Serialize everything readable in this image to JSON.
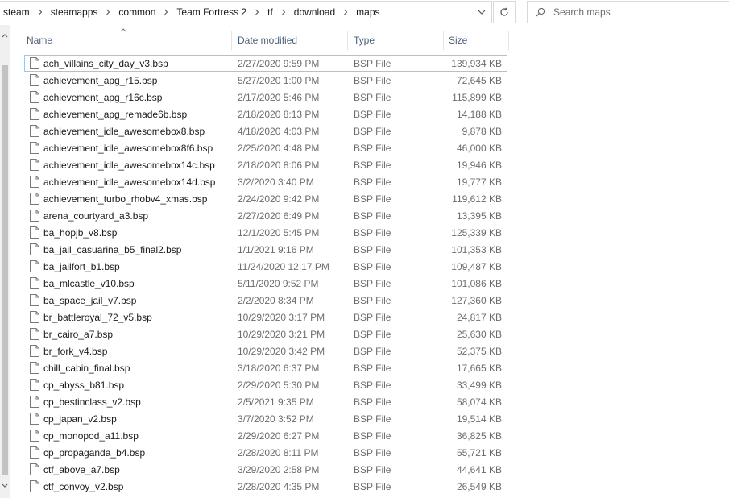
{
  "address_bar": {
    "breadcrumbs": [
      "steam",
      "steamapps",
      "common",
      "Team Fortress 2",
      "tf",
      "download",
      "maps"
    ],
    "separator_icon": "chevron-right-icon",
    "dropdown_icon": "chevron-down-icon",
    "refresh_icon": "refresh-icon"
  },
  "search": {
    "placeholder": "Search maps",
    "value": "",
    "icon": "search-icon"
  },
  "columns": {
    "name": "Name",
    "date_modified": "Date modified",
    "type": "Type",
    "size": "Size",
    "sort_column": "Name",
    "sort_direction": "ascending"
  },
  "files": [
    {
      "name": "ach_villains_city_day_v3.bsp",
      "date": "2/27/2020 9:59 PM",
      "type": "BSP File",
      "size": "139,934 KB"
    },
    {
      "name": "achievement_apg_r15.bsp",
      "date": "5/27/2020 1:00 PM",
      "type": "BSP File",
      "size": "72,645 KB"
    },
    {
      "name": "achievement_apg_r16c.bsp",
      "date": "2/17/2020 5:46 PM",
      "type": "BSP File",
      "size": "115,899 KB"
    },
    {
      "name": "achievement_apg_remade6b.bsp",
      "date": "2/18/2020 8:13 PM",
      "type": "BSP File",
      "size": "14,188 KB"
    },
    {
      "name": "achievement_idle_awesomebox8.bsp",
      "date": "4/18/2020 4:03 PM",
      "type": "BSP File",
      "size": "9,878 KB"
    },
    {
      "name": "achievement_idle_awesomebox8f6.bsp",
      "date": "2/25/2020 4:48 PM",
      "type": "BSP File",
      "size": "46,000 KB"
    },
    {
      "name": "achievement_idle_awesomebox14c.bsp",
      "date": "2/18/2020 8:06 PM",
      "type": "BSP File",
      "size": "19,946 KB"
    },
    {
      "name": "achievement_idle_awesomebox14d.bsp",
      "date": "3/2/2020 3:40 PM",
      "type": "BSP File",
      "size": "19,777 KB"
    },
    {
      "name": "achievement_turbo_rhobv4_xmas.bsp",
      "date": "2/24/2020 9:42 PM",
      "type": "BSP File",
      "size": "119,612 KB"
    },
    {
      "name": "arena_courtyard_a3.bsp",
      "date": "2/27/2020 6:49 PM",
      "type": "BSP File",
      "size": "13,395 KB"
    },
    {
      "name": "ba_hopjb_v8.bsp",
      "date": "12/1/2020 5:45 PM",
      "type": "BSP File",
      "size": "125,339 KB"
    },
    {
      "name": "ba_jail_casuarina_b5_final2.bsp",
      "date": "1/1/2021 9:16 PM",
      "type": "BSP File",
      "size": "101,353 KB"
    },
    {
      "name": "ba_jailfort_b1.bsp",
      "date": "11/24/2020 12:17 PM",
      "type": "BSP File",
      "size": "109,487 KB"
    },
    {
      "name": "ba_mlcastle_v10.bsp",
      "date": "5/11/2020 9:52 PM",
      "type": "BSP File",
      "size": "101,086 KB"
    },
    {
      "name": "ba_space_jail_v7.bsp",
      "date": "2/2/2020 8:34 PM",
      "type": "BSP File",
      "size": "127,360 KB"
    },
    {
      "name": "br_battleroyal_72_v5.bsp",
      "date": "10/29/2020 3:17 PM",
      "type": "BSP File",
      "size": "24,817 KB"
    },
    {
      "name": "br_cairo_a7.bsp",
      "date": "10/29/2020 3:21 PM",
      "type": "BSP File",
      "size": "25,630 KB"
    },
    {
      "name": "br_fork_v4.bsp",
      "date": "10/29/2020 3:42 PM",
      "type": "BSP File",
      "size": "52,375 KB"
    },
    {
      "name": "chill_cabin_final.bsp",
      "date": "3/18/2020 6:37 PM",
      "type": "BSP File",
      "size": "17,665 KB"
    },
    {
      "name": "cp_abyss_b81.bsp",
      "date": "2/29/2020 5:30 PM",
      "type": "BSP File",
      "size": "33,499 KB"
    },
    {
      "name": "cp_bestinclass_v2.bsp",
      "date": "2/5/2021 9:35 PM",
      "type": "BSP File",
      "size": "58,074 KB"
    },
    {
      "name": "cp_japan_v2.bsp",
      "date": "3/7/2020 3:52 PM",
      "type": "BSP File",
      "size": "19,514 KB"
    },
    {
      "name": "cp_monopod_a11.bsp",
      "date": "2/29/2020 6:27 PM",
      "type": "BSP File",
      "size": "36,825 KB"
    },
    {
      "name": "cp_propaganda_b4.bsp",
      "date": "2/28/2020 8:11 PM",
      "type": "BSP File",
      "size": "55,721 KB"
    },
    {
      "name": "ctf_above_a7.bsp",
      "date": "3/29/2020 2:58 PM",
      "type": "BSP File",
      "size": "44,641 KB"
    },
    {
      "name": "ctf_convoy_v2.bsp",
      "date": "2/28/2020 4:35 PM",
      "type": "BSP File",
      "size": "26,549 KB"
    }
  ],
  "focused_row_index": 0,
  "file_icon": "document-icon",
  "colors": {
    "header_text": "#4c607a",
    "secondary_text": "#6d6d6d",
    "focus_border": "#99c8ee"
  }
}
